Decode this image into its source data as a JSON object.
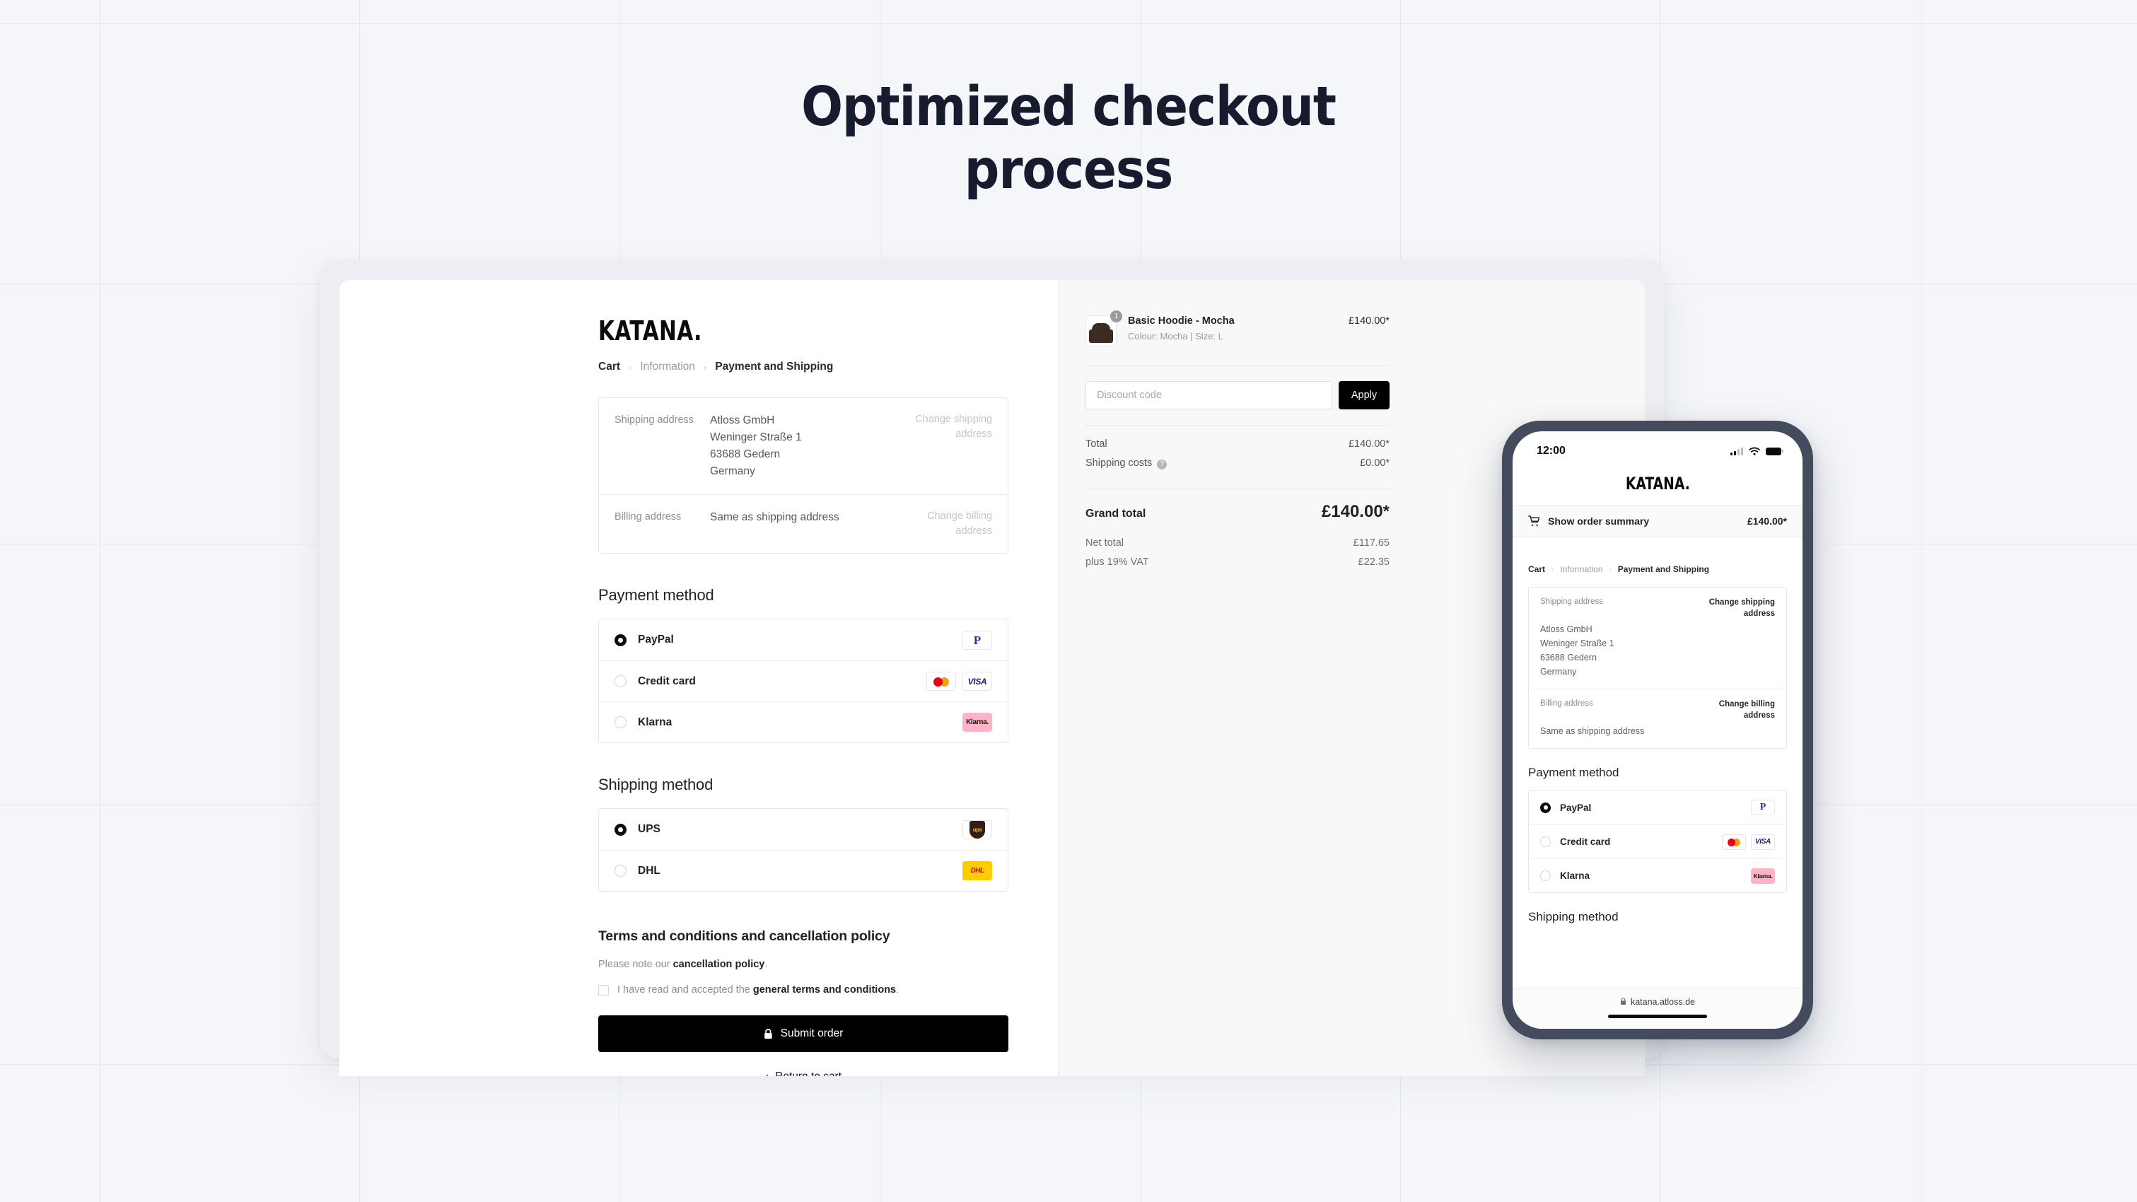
{
  "page": {
    "headline_line1": "Optimized checkout",
    "headline_line2": "process",
    "accent_dark": "#161b2e",
    "bg": "#f4f6f9"
  },
  "desktop": {
    "brand": "KATANA.",
    "breadcrumb": [
      {
        "label": "Cart",
        "state": "link"
      },
      {
        "label": "Information",
        "state": "muted"
      },
      {
        "label": "Payment and Shipping",
        "state": "active"
      }
    ],
    "breadcrumb_separator": "›",
    "address": {
      "shipping_label": "Shipping address",
      "shipping_lines": [
        "Atloss GmbH",
        "Weninger Straße 1",
        "63688 Gedern",
        "Germany"
      ],
      "shipping_change": "Change shipping address",
      "billing_label": "Billing address",
      "billing_value": "Same as shipping address",
      "billing_change": "Change billing address"
    },
    "payment": {
      "title": "Payment method",
      "options": [
        {
          "label": "PayPal",
          "selected": true,
          "logos": [
            "paypal"
          ]
        },
        {
          "label": "Credit card",
          "selected": false,
          "logos": [
            "mastercard",
            "visa"
          ]
        },
        {
          "label": "Klarna",
          "selected": false,
          "logos": [
            "klarna"
          ]
        }
      ]
    },
    "shipping": {
      "title": "Shipping method",
      "options": [
        {
          "label": "UPS",
          "selected": true,
          "logos": [
            "ups"
          ]
        },
        {
          "label": "DHL",
          "selected": false,
          "logos": [
            "dhl"
          ]
        }
      ]
    },
    "terms": {
      "title": "Terms and conditions and cancellation policy",
      "note_pre": "Please note our ",
      "note_link": "cancellation policy",
      "note_post": ".",
      "checkbox_pre": "I have read and accepted the ",
      "checkbox_link": "general terms and conditions",
      "checkbox_post": ".",
      "checked": false
    },
    "submit_label": "Submit order",
    "return_label": "Return to cart",
    "return_chevron": "‹"
  },
  "summary": {
    "item": {
      "name": "Basic Hoodie - Mocha",
      "variant": "Colour: Mocha | Size: L",
      "price": "£140.00*",
      "qty": "1"
    },
    "discount_placeholder": "Discount code",
    "discount_value": "",
    "apply_label": "Apply",
    "rows": [
      {
        "label": "Total",
        "value": "£140.00*",
        "help": false
      },
      {
        "label": "Shipping costs",
        "value": "£0.00*",
        "help": true
      }
    ],
    "help_glyph": "?",
    "grand_label": "Grand total",
    "grand_value": "£140.00*",
    "net_rows": [
      {
        "label": "Net total",
        "value": "£117.65"
      },
      {
        "label": "plus 19% VAT",
        "value": "£22.35"
      }
    ]
  },
  "phone": {
    "status_time": "12:00",
    "brand": "KATANA.",
    "summary_toggle": "Show order summary",
    "summary_price": "£140.00*",
    "breadcrumb": [
      {
        "label": "Cart",
        "state": "link"
      },
      {
        "label": "Information",
        "state": "muted"
      },
      {
        "label": "Payment and Shipping",
        "state": "active"
      }
    ],
    "breadcrumb_separator": "›",
    "address": {
      "shipping_label": "Shipping address",
      "shipping_change": "Change shipping address",
      "shipping_lines": [
        "Atloss GmbH",
        "Weninger Straße 1",
        "63688 Gedern",
        "Germany"
      ],
      "billing_label": "Billing address",
      "billing_change": "Change billing address",
      "billing_value": "Same as shipping address"
    },
    "payment_title": "Payment method",
    "payment_options": [
      {
        "label": "PayPal",
        "selected": true,
        "logos": [
          "paypal"
        ]
      },
      {
        "label": "Credit card",
        "selected": false,
        "logos": [
          "mastercard",
          "visa"
        ]
      },
      {
        "label": "Klarna",
        "selected": false,
        "logos": [
          "klarna"
        ]
      }
    ],
    "shipping_title": "Shipping method",
    "url": "katana.atloss.de"
  },
  "logos": {
    "paypal": "P",
    "visa": "VISA",
    "klarna": "Klarna.",
    "ups": "ups",
    "dhl": "DHL"
  }
}
